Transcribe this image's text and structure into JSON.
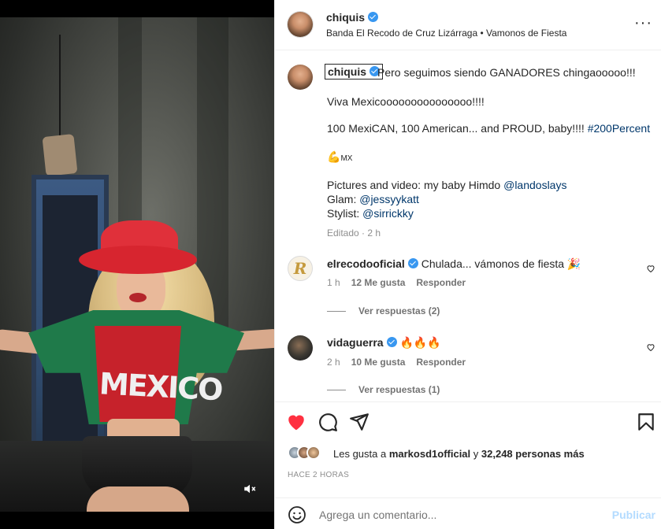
{
  "post": {
    "username": "chiquis",
    "music": "Banda El Recodo de Cruz Lizárraga • Vamonos de Fiesta",
    "more_icon": "more-horizontal-icon"
  },
  "caption": {
    "username": "chiquis",
    "line1": "Pero seguimos siendo GANADORES chingaooooo!!!",
    "line2": "Viva Mexicooooooooooooooo!!!!",
    "line3_text": "100 MexiCAN, 100 American... and PROUD, baby!!!! ",
    "line3_tag": "#200Percent",
    "line4_emoji": "💪",
    "line4_text": "MX",
    "credit1_text": "Pictures and video: my baby Himdo ",
    "credit1_mention": "@landoslays",
    "credit2_text": "Glam: ",
    "credit2_mention": "@jessyykatt",
    "credit3_text": "Stylist: ",
    "credit3_mention": "@sirrickky",
    "edited": "Editado · 2 h"
  },
  "comments": [
    {
      "username": "elrecodooficial",
      "avatar_letter": "R",
      "text": "Chulada... vámonos de fiesta 🎉",
      "time": "1 h",
      "likes": "12 Me gusta",
      "reply": "Responder",
      "view_replies": "Ver respuestas (2)"
    },
    {
      "username": "vidaguerra",
      "text": "🔥🔥🔥",
      "time": "2 h",
      "likes": "10 Me gusta",
      "reply": "Responder",
      "view_replies": "Ver respuestas (1)"
    }
  ],
  "actions": {
    "like_icon": "heart-filled-icon",
    "comment_icon": "comment-icon",
    "share_icon": "send-icon",
    "save_icon": "bookmark-icon",
    "likes_prefix": "Les gusta a ",
    "likes_user": "markosd1official",
    "likes_middle": " y ",
    "likes_count": "32,248 personas más",
    "time_ago": "HACE 2 HORAS"
  },
  "add_comment": {
    "placeholder": "Agrega un comentario...",
    "publish_label": "Publicar",
    "emoji_icon": "emoji-icon"
  },
  "media": {
    "jersey_text": "MEXICO",
    "mute_icon": "muted-speaker-icon"
  },
  "colors": {
    "like_red": "#ff3040",
    "verified_blue": "#3897f0",
    "link": "#00376b",
    "publish_disabled": "#b3dbff"
  }
}
